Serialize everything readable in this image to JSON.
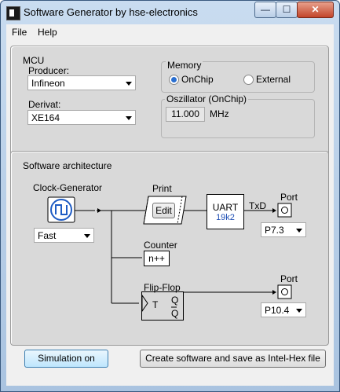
{
  "window": {
    "title": "Software Generator by hse-electronics",
    "min_label": "—",
    "max_label": "☐",
    "close_label": "✕"
  },
  "menu": {
    "file": "File",
    "help": "Help"
  },
  "mcu": {
    "group_label": "MCU",
    "producer_label": "Producer:",
    "producer_value": "Infineon",
    "derivat_label": "Derivat:",
    "derivat_value": "XE164",
    "memory_label": "Memory",
    "onchip_label": "OnChip",
    "external_label": "External",
    "memory_selected": "OnChip",
    "oscillator_label": "Oszillator (OnChip)",
    "oscillator_value": "11.000",
    "oscillator_unit": "MHz"
  },
  "architecture": {
    "group_label": "Software architecture",
    "clock_label": "Clock-Generator",
    "clock_value": "Fast",
    "print_label": "Print",
    "edit_label": "Edit",
    "uart_label": "UART",
    "uart_baud": "19k2",
    "txd_label": "TxD",
    "port1_label": "Port",
    "port1_value": "P7.3",
    "counter_label": "Counter",
    "counter_box": "n++",
    "flipflop_label": "Flip-Flop",
    "ff_t": "T",
    "ff_q": "Q",
    "ff_qbar": "Q",
    "port2_label": "Port",
    "port2_value": "P10.4"
  },
  "buttons": {
    "simulation": "Simulation on",
    "create": "Create software and save as Intel-Hex file"
  }
}
